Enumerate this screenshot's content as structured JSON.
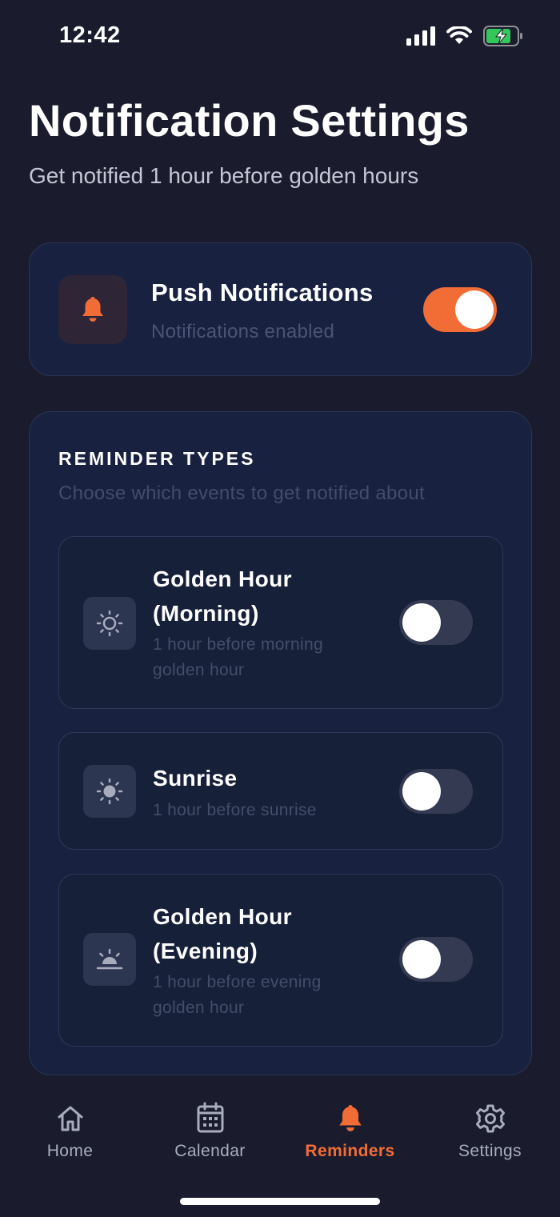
{
  "status_bar": {
    "time": "12:42"
  },
  "header": {
    "title": "Notification Settings",
    "subtitle": "Get notified 1 hour before golden hours"
  },
  "push": {
    "title": "Push Notifications",
    "status": "Notifications enabled",
    "enabled": true,
    "icon": "bell-icon"
  },
  "reminders": {
    "title": "REMINDER TYPES",
    "subtitle": "Choose which events to get notified about",
    "items": [
      {
        "title": "Golden Hour (Morning)",
        "subtitle": "1 hour before morning golden hour",
        "enabled": false,
        "icon": "sun-outline-icon"
      },
      {
        "title": "Sunrise",
        "subtitle": "1 hour before sunrise",
        "enabled": false,
        "icon": "sun-icon"
      },
      {
        "title": "Golden Hour (Evening)",
        "subtitle": "1 hour before evening golden hour",
        "enabled": false,
        "icon": "sunset-icon"
      }
    ]
  },
  "nav": {
    "items": [
      {
        "label": "Home",
        "icon": "home-icon",
        "active": false
      },
      {
        "label": "Calendar",
        "icon": "calendar-icon",
        "active": false
      },
      {
        "label": "Reminders",
        "icon": "bell-icon",
        "active": true
      },
      {
        "label": "Settings",
        "icon": "gear-icon",
        "active": false
      }
    ]
  },
  "colors": {
    "background": "#1a1c2e",
    "card": "#182140",
    "accent": "#f26d35",
    "battery": "#34c759"
  }
}
